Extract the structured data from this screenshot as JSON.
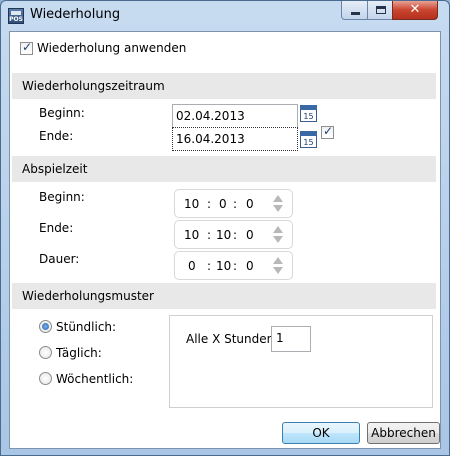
{
  "window": {
    "title": "Wiederholung",
    "app_icon_text": "POS",
    "close_glyph": "✕"
  },
  "enable_repeat": {
    "label": "Wiederholung anwenden",
    "checked": true
  },
  "zeitraum": {
    "header": "Wiederholungszeitraum",
    "begin_label": "Beginn:",
    "begin_value": "02.04.2013",
    "end_label": "Ende:",
    "end_value": "16.04.2013",
    "calendar_day": "15",
    "end_checked": true
  },
  "abspielzeit": {
    "header": "Abspielzeit",
    "begin_label": "Beginn:",
    "begin": {
      "h": "10",
      "m": "0",
      "s": "0"
    },
    "end_label": "Ende:",
    "end": {
      "h": "10",
      "m": "10",
      "s": "0"
    },
    "duration_label": "Dauer:",
    "duration": {
      "h": "0",
      "m": "10",
      "s": "0"
    },
    "separator": ":"
  },
  "muster": {
    "header": "Wiederholungsmuster",
    "options": [
      "Stündlich:",
      "Täglich:",
      "Wöchentlich:"
    ],
    "selected_index": 0,
    "every_x_label": "Alle X Stunden:",
    "every_x_value": "1"
  },
  "buttons": {
    "ok": "OK",
    "cancel": "Abbrechen"
  },
  "colors": {
    "title_bar": "#b9d1ea",
    "close_button": "#c9452f",
    "section_header": "#e8e8e8"
  }
}
